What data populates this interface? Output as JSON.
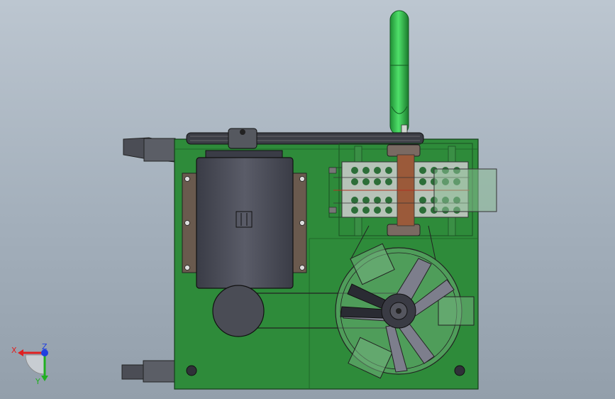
{
  "viewport": {
    "background": "#a9b4bf",
    "model_color": "#2e8b3a",
    "motor_color": "#4a4c58",
    "pipe_color": "#2fc04a"
  },
  "triad": {
    "x_label": "X",
    "y_label": "Y",
    "z_label": "Z",
    "x_color": "#e02020",
    "y_color": "#20b020",
    "z_color": "#2040e0"
  }
}
